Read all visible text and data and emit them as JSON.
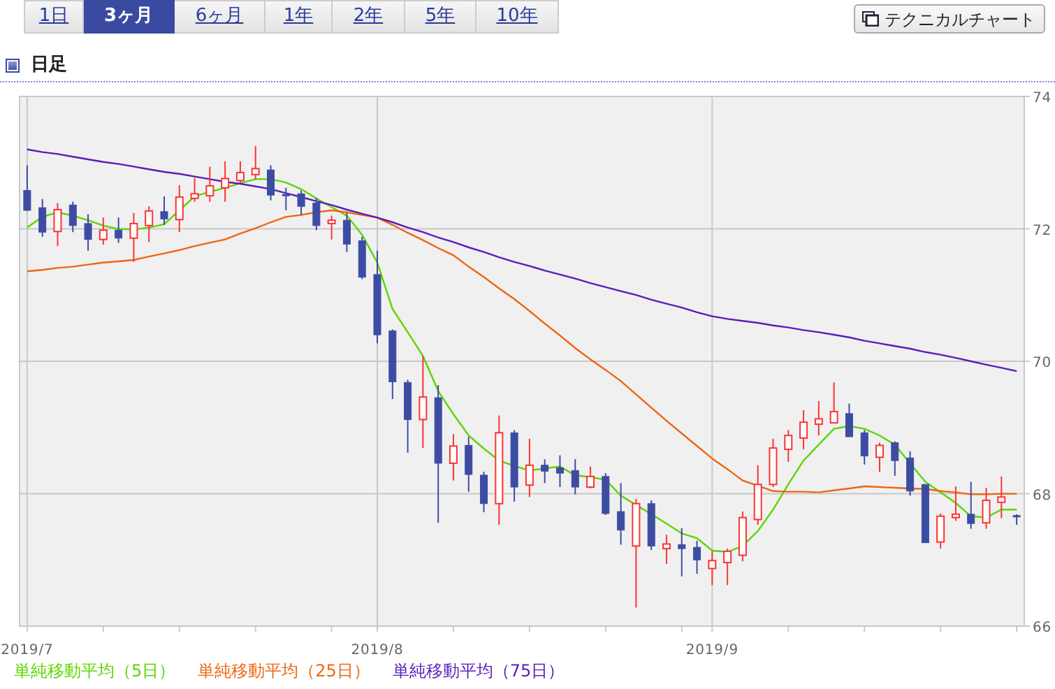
{
  "tabs": [
    {
      "label": "1日",
      "selected": false
    },
    {
      "label": "3ヶ月",
      "selected": true
    },
    {
      "label": "6ヶ月",
      "selected": false
    },
    {
      "label": "1年",
      "selected": false
    },
    {
      "label": "2年",
      "selected": false
    },
    {
      "label": "5年",
      "selected": false
    },
    {
      "label": "10年",
      "selected": false
    }
  ],
  "technical_chart_button": {
    "label": "テクニカルチャート"
  },
  "section": {
    "title": "日足"
  },
  "chart": {
    "chart_data": {
      "type": "candlestick",
      "grid": true,
      "ylim": [
        66,
        74
      ],
      "yticks": [
        66,
        68,
        70,
        72,
        74
      ],
      "categories": [
        "2019/7",
        null,
        null,
        null,
        null,
        null,
        null,
        null,
        null,
        null,
        null,
        null,
        null,
        null,
        null,
        null,
        null,
        null,
        null,
        null,
        null,
        null,
        null,
        "2019/8",
        null,
        null,
        null,
        null,
        null,
        null,
        null,
        null,
        null,
        null,
        null,
        null,
        null,
        null,
        null,
        null,
        null,
        null,
        null,
        null,
        null,
        "2019/9",
        null,
        null,
        null,
        null,
        null,
        null,
        null,
        null,
        null,
        null,
        null,
        null,
        null,
        null,
        null,
        null,
        null,
        null,
        null,
        null
      ],
      "ohlc": [
        [
          72.58,
          72.96,
          72.27,
          72.28
        ],
        [
          72.32,
          72.45,
          71.88,
          71.95
        ],
        [
          71.96,
          72.39,
          71.74,
          72.29
        ],
        [
          72.36,
          72.41,
          71.95,
          72.05
        ],
        [
          72.08,
          72.22,
          71.67,
          71.84
        ],
        [
          71.84,
          72.17,
          71.76,
          71.98
        ],
        [
          71.98,
          72.17,
          71.79,
          71.86
        ],
        [
          71.86,
          72.24,
          71.5,
          72.08
        ],
        [
          72.05,
          72.34,
          71.8,
          72.27
        ],
        [
          72.26,
          72.49,
          72.06,
          72.15
        ],
        [
          72.14,
          72.66,
          71.95,
          72.48
        ],
        [
          72.46,
          72.77,
          72.41,
          72.53
        ],
        [
          72.5,
          72.94,
          72.41,
          72.65
        ],
        [
          72.62,
          73.02,
          72.41,
          72.76
        ],
        [
          72.73,
          73.02,
          72.7,
          72.85
        ],
        [
          72.82,
          73.25,
          72.75,
          72.91
        ],
        [
          72.89,
          72.96,
          72.43,
          72.51
        ],
        [
          72.52,
          72.62,
          72.28,
          72.51
        ],
        [
          72.53,
          72.58,
          72.21,
          72.34
        ],
        [
          72.39,
          72.47,
          71.98,
          72.05
        ],
        [
          72.08,
          72.2,
          71.84,
          72.13
        ],
        [
          72.13,
          72.24,
          71.65,
          71.77
        ],
        [
          71.82,
          71.88,
          71.24,
          71.27
        ],
        [
          71.31,
          71.67,
          70.27,
          70.4
        ],
        [
          70.46,
          70.48,
          69.43,
          69.69
        ],
        [
          69.68,
          69.72,
          68.62,
          69.12
        ],
        [
          69.12,
          70.08,
          68.69,
          69.46
        ],
        [
          69.45,
          69.64,
          67.56,
          68.46
        ],
        [
          68.46,
          68.9,
          68.2,
          68.72
        ],
        [
          68.73,
          68.86,
          68.03,
          68.29
        ],
        [
          68.28,
          68.33,
          67.72,
          67.85
        ],
        [
          67.85,
          69.18,
          67.53,
          68.92
        ],
        [
          68.92,
          68.96,
          67.88,
          68.1
        ],
        [
          68.13,
          68.83,
          67.95,
          68.43
        ],
        [
          68.43,
          68.52,
          68.16,
          68.34
        ],
        [
          68.39,
          68.58,
          68.1,
          68.31
        ],
        [
          68.35,
          68.52,
          67.99,
          68.1
        ],
        [
          68.1,
          68.41,
          68.08,
          68.26
        ],
        [
          68.26,
          68.31,
          67.68,
          67.7
        ],
        [
          67.73,
          68.16,
          67.23,
          67.45
        ],
        [
          67.21,
          67.92,
          66.28,
          67.85
        ],
        [
          67.85,
          67.9,
          67.15,
          67.21
        ],
        [
          67.17,
          67.38,
          66.94,
          67.24
        ],
        [
          67.23,
          67.48,
          66.75,
          67.17
        ],
        [
          67.19,
          67.29,
          66.79,
          67.0
        ],
        [
          66.87,
          67.13,
          66.62,
          66.99
        ],
        [
          66.96,
          67.17,
          66.62,
          67.13
        ],
        [
          67.07,
          67.73,
          66.98,
          67.64
        ],
        [
          67.61,
          68.43,
          67.53,
          68.14
        ],
        [
          68.14,
          68.83,
          68.1,
          68.69
        ],
        [
          68.67,
          68.96,
          68.48,
          68.88
        ],
        [
          68.84,
          69.26,
          68.67,
          69.08
        ],
        [
          69.05,
          69.4,
          68.88,
          69.13
        ],
        [
          69.07,
          69.68,
          69.07,
          69.24
        ],
        [
          69.21,
          69.36,
          68.86,
          68.86
        ],
        [
          68.92,
          68.96,
          68.44,
          68.57
        ],
        [
          68.55,
          68.77,
          68.33,
          68.73
        ],
        [
          68.77,
          68.79,
          68.27,
          68.5
        ],
        [
          68.54,
          68.64,
          67.97,
          68.04
        ],
        [
          68.14,
          68.14,
          67.26,
          67.26
        ],
        [
          67.27,
          67.7,
          67.17,
          67.66
        ],
        [
          67.64,
          68.11,
          67.59,
          67.69
        ],
        [
          67.69,
          68.18,
          67.47,
          67.55
        ],
        [
          67.56,
          68.09,
          67.47,
          67.9
        ],
        [
          67.87,
          68.26,
          67.63,
          67.95
        ],
        [
          67.67,
          67.69,
          67.53,
          67.66
        ]
      ],
      "series": [
        {
          "name": "単純移動平均（5日）",
          "type": "line",
          "color": "#5cd600",
          "values": [
            72.02,
            72.18,
            72.25,
            72.2,
            72.13,
            72.05,
            72.0,
            71.99,
            72.02,
            72.07,
            72.28,
            72.49,
            72.56,
            72.62,
            72.69,
            72.75,
            72.75,
            72.7,
            72.6,
            72.46,
            72.33,
            72.2,
            71.91,
            71.49,
            70.79,
            70.44,
            70.08,
            69.55,
            69.2,
            68.88,
            68.68,
            68.5,
            68.42,
            68.35,
            68.38,
            68.41,
            68.28,
            68.25,
            68.21,
            67.97,
            67.83,
            67.69,
            67.55,
            67.4,
            67.33,
            67.14,
            67.12,
            67.21,
            67.44,
            67.76,
            68.14,
            68.5,
            68.74,
            68.98,
            69.02,
            68.98,
            68.88,
            68.74,
            68.46,
            68.18,
            68.02,
            67.86,
            67.66,
            67.64,
            67.76,
            67.76
          ]
        },
        {
          "name": "単純移動平均（25日）",
          "type": "line",
          "color": "#ee6611",
          "values": [
            71.36,
            71.38,
            71.41,
            71.43,
            71.46,
            71.49,
            71.51,
            71.53,
            71.58,
            71.63,
            71.68,
            71.74,
            71.79,
            71.84,
            71.93,
            72.01,
            72.1,
            72.18,
            72.21,
            72.25,
            72.28,
            72.25,
            72.21,
            72.17,
            72.06,
            71.94,
            71.83,
            71.71,
            71.6,
            71.43,
            71.27,
            71.1,
            70.94,
            70.76,
            70.57,
            70.39,
            70.2,
            70.03,
            69.87,
            69.7,
            69.5,
            69.3,
            69.1,
            68.91,
            68.72,
            68.53,
            68.37,
            68.2,
            68.12,
            68.04,
            68.03,
            68.03,
            68.02,
            68.05,
            68.08,
            68.11,
            68.1,
            68.09,
            68.08,
            68.07,
            68.04,
            68.02,
            67.99,
            67.99,
            68.0,
            68.0
          ]
        },
        {
          "name": "単純移動平均（75日）",
          "type": "line",
          "color": "#5a1cbb",
          "values": [
            73.2,
            73.16,
            73.13,
            73.09,
            73.05,
            73.01,
            72.98,
            72.94,
            72.9,
            72.86,
            72.83,
            72.79,
            72.75,
            72.71,
            72.68,
            72.64,
            72.6,
            72.54,
            72.48,
            72.42,
            72.36,
            72.29,
            72.23,
            72.17,
            72.1,
            72.02,
            71.95,
            71.87,
            71.8,
            71.72,
            71.65,
            71.57,
            71.5,
            71.44,
            71.37,
            71.31,
            71.25,
            71.18,
            71.12,
            71.06,
            71.0,
            70.93,
            70.87,
            70.81,
            70.74,
            70.68,
            70.64,
            70.61,
            70.58,
            70.54,
            70.51,
            70.47,
            70.44,
            70.4,
            70.36,
            70.31,
            70.27,
            70.23,
            70.19,
            70.14,
            70.1,
            70.05,
            70.0,
            69.95,
            69.9,
            69.85
          ]
        }
      ]
    }
  }
}
